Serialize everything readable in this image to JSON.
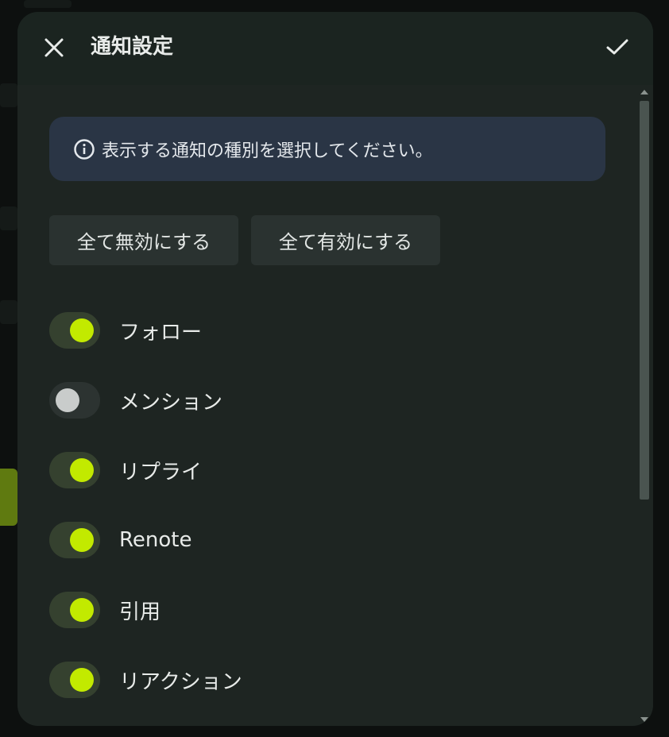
{
  "dialog": {
    "title": "通知設定",
    "close_icon": "close-icon",
    "confirm_icon": "checkmark-icon"
  },
  "info": {
    "icon": "info-icon",
    "text": "表示する通知の種別を選択してください。"
  },
  "actions": {
    "disable_all": "全て無効にする",
    "enable_all": "全て有効にする"
  },
  "toggles": [
    {
      "label": "フォロー",
      "on": true
    },
    {
      "label": "メンション",
      "on": false
    },
    {
      "label": "リプライ",
      "on": true
    },
    {
      "label": "Renote",
      "on": true
    },
    {
      "label": "引用",
      "on": true
    },
    {
      "label": "リアクション",
      "on": true
    },
    {
      "label": "",
      "on": true
    }
  ],
  "colors": {
    "accent": "#c2ea00",
    "dialog_bg": "#1e2522",
    "info_bg": "#2a3545"
  }
}
